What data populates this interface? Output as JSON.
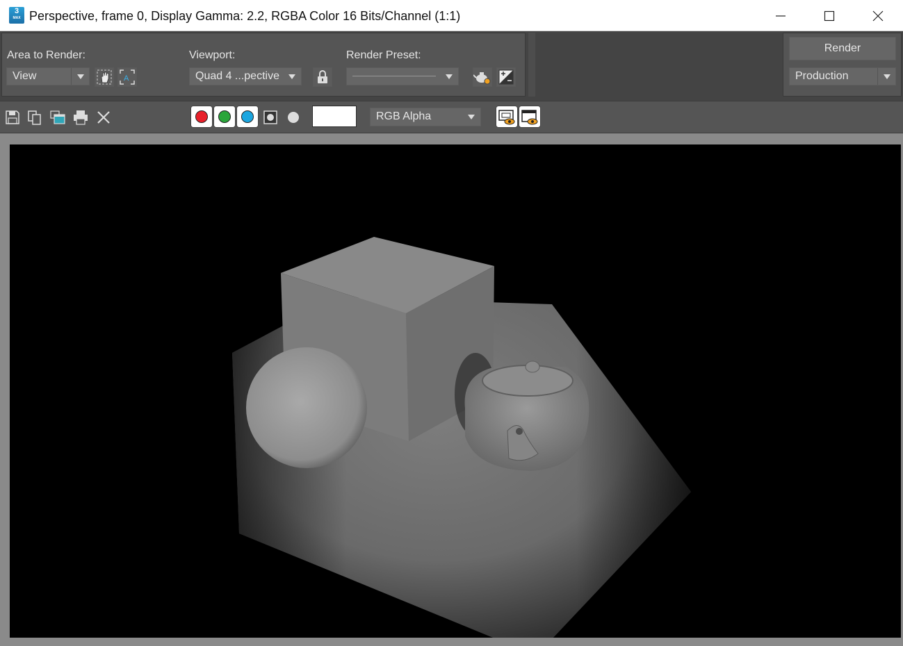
{
  "window": {
    "title": "Perspective, frame 0, Display Gamma: 2.2, RGBA Color 16 Bits/Channel (1:1)",
    "app_icon_label": "3",
    "app_icon_sub": "MAX"
  },
  "options": {
    "area_label": "Area to Render:",
    "area_value": "View",
    "viewport_label": "Viewport:",
    "viewport_value": "Quad 4 ...pective",
    "preset_label": "Render Preset:",
    "preset_value": ""
  },
  "render_panel": {
    "render_label": "Render",
    "mode_value": "Production"
  },
  "toolbar": {
    "channel_value": "RGB Alpha",
    "colors": {
      "red": "#e8202a",
      "green": "#2aa53a",
      "blue": "#1ba6e0"
    }
  }
}
